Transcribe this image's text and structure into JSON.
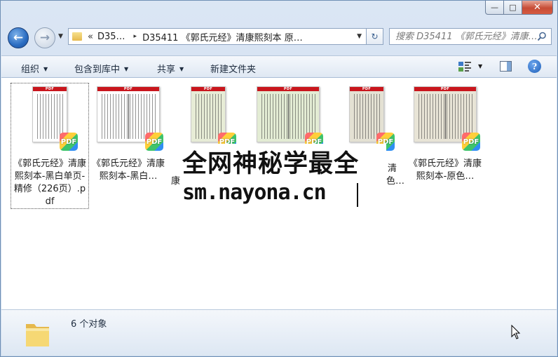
{
  "window": {
    "caption": {
      "minimize": "—",
      "maximize": "□",
      "close": "✕"
    }
  },
  "nav": {
    "back_glyph": "←",
    "forward_glyph": "→",
    "address": {
      "overflow": "«",
      "segment1": "D35…",
      "separator": "▸",
      "segment2": "D35411 《郭氏元经》清康熙刻本 原…"
    },
    "refresh_glyph": "↻",
    "search_placeholder": "搜索 D35411 《郭氏元经》清康…"
  },
  "toolbar": {
    "organize": "组织",
    "include_library": "包含到库中",
    "share": "共享",
    "new_folder": "新建文件夹",
    "help": "?"
  },
  "files": [
    {
      "name": "《郭氏元经》清康熙刻本-黑白单页-精修（226页）.pdf",
      "tone": "#ffffff",
      "spread": false,
      "selected": true
    },
    {
      "name": "《郭氏元经》清康熙刻本-黑白…",
      "tone": "#ffffff",
      "spread": true,
      "selected": false
    },
    {
      "name": "",
      "tone": "#e7ecd6",
      "spread": false,
      "selected": false
    },
    {
      "name": "",
      "tone": "#e3ecd4",
      "spread": true,
      "selected": false
    },
    {
      "name": "",
      "tone": "#e4e1d3",
      "spread": false,
      "selected": false
    },
    {
      "name": "《郭氏元经》清康熙刻本-原色…",
      "tone": "#e8e4d6",
      "spread": true,
      "selected": false
    }
  ],
  "thumb_banner": "PDF",
  "badge_label": "PDF",
  "watermark": {
    "line1": "全网神秘学最全",
    "line2": "sm.nayona.cn",
    "partial_left": "康",
    "partial_right_top": "清",
    "partial_right_bottom": "色…"
  },
  "details": {
    "status": "6 个对象"
  }
}
